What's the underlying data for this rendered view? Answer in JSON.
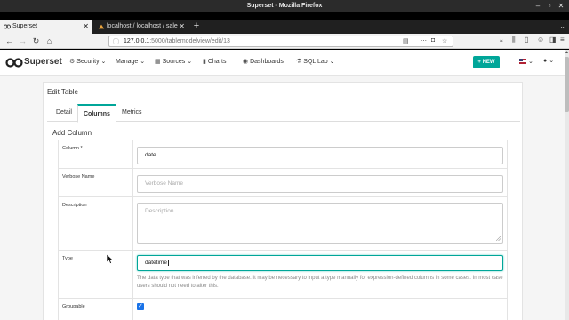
{
  "window": {
    "title": "Superset - Mozilla Firefox"
  },
  "tabs": [
    {
      "label": "Superset",
      "active": true
    },
    {
      "label": "localhost / localhost / sale",
      "active": false
    }
  ],
  "address_bar": {
    "host": "127.0.0.1",
    "path": ":5000/tablemodelview/edit/13"
  },
  "app": {
    "brand": "Superset",
    "menu": [
      {
        "label": "Security",
        "icon": "lock-icon",
        "dropdown": true
      },
      {
        "label": "Manage",
        "icon": "",
        "dropdown": true
      },
      {
        "label": "Sources",
        "icon": "database-icon",
        "dropdown": true
      },
      {
        "label": "Charts",
        "icon": "bar-chart-icon",
        "dropdown": false
      },
      {
        "label": "Dashboards",
        "icon": "dashboard-icon",
        "dropdown": false
      },
      {
        "label": "SQL Lab",
        "icon": "flask-icon",
        "dropdown": true
      }
    ],
    "new_button": "+ NEW",
    "accent_color": "#00a699"
  },
  "panel": {
    "title": "Edit Table",
    "tabs": [
      "Detail",
      "Columns",
      "Metrics"
    ],
    "active_tab": "Columns",
    "section_title": "Add Column",
    "form": {
      "column": {
        "label": "Column *",
        "value": "date"
      },
      "verbose_name": {
        "label": "Verbose Name",
        "placeholder": "Verbose Name"
      },
      "description": {
        "label": "Description",
        "placeholder": "Description"
      },
      "type": {
        "label": "Type",
        "value": "datetime",
        "help": "The data type that was inferred by the database. It may be necessary to input a type manually for expression-defined columns in some cases. In most case users should not need to alter this."
      },
      "groupable": {
        "label": "Groupable",
        "checked": true
      }
    }
  }
}
